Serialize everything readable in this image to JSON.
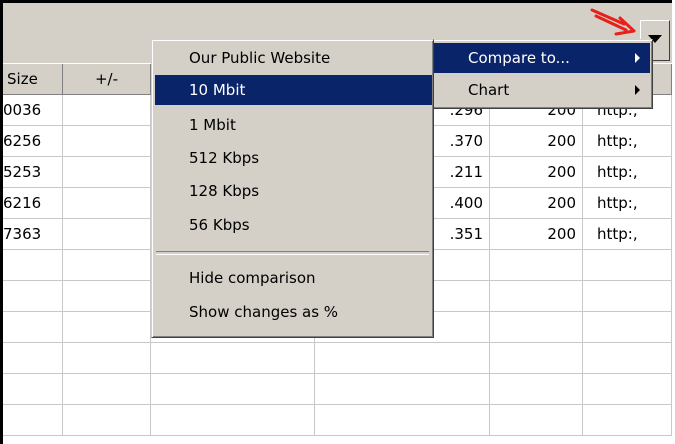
{
  "header": {
    "columns": [
      {
        "label": "Size"
      },
      {
        "label": "+/-"
      },
      {
        "label": ""
      },
      {
        "label": ""
      },
      {
        "label": ""
      },
      {
        "label": ""
      }
    ]
  },
  "rows": [
    {
      "size": "0036",
      "time": ".296",
      "status": "200",
      "url": "http:,"
    },
    {
      "size": "6256",
      "time": ".370",
      "status": "200",
      "url": "http:,"
    },
    {
      "size": "5253",
      "time": ".211",
      "status": "200",
      "url": "http:,"
    },
    {
      "size": "6216",
      "time": ".400",
      "status": "200",
      "url": "http:,"
    },
    {
      "size": "7363",
      "time": ".351",
      "status": "200",
      "url": "http:,"
    }
  ],
  "context_menu": {
    "items": [
      {
        "label": "Compare to...",
        "selected": true
      },
      {
        "label": "Chart",
        "selected": false
      }
    ]
  },
  "submenu": {
    "items": [
      {
        "label": "Our Public Website"
      },
      {
        "label": "10 Mbit",
        "selected": true
      },
      {
        "label": "1 Mbit"
      },
      {
        "label": "512 Kbps"
      },
      {
        "label": "128 Kbps"
      },
      {
        "label": "56 Kbps"
      }
    ],
    "bottom_items": [
      {
        "label": "Hide comparison"
      },
      {
        "label": "Show changes as %"
      }
    ]
  },
  "colors": {
    "menu_bg": "#d4d0c8",
    "highlight": "#0a246a",
    "annotation_arrow": "#e8201a"
  }
}
